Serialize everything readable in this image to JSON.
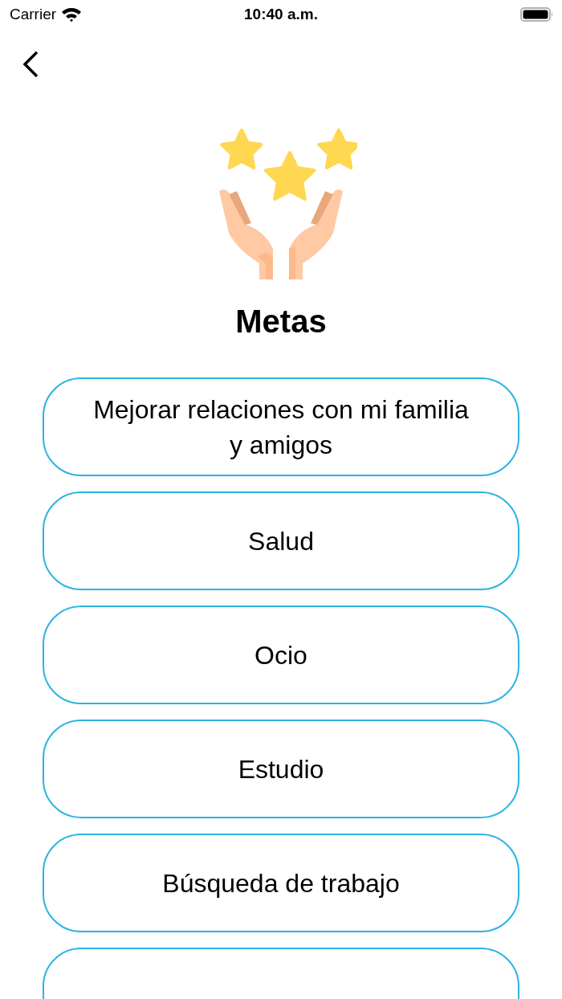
{
  "status_bar": {
    "carrier": "Carrier",
    "time": "10:40 a.m."
  },
  "title": "Metas",
  "goals": [
    {
      "kind": "goal",
      "label": "Mejorar relaciones con mi familia y amigos"
    },
    {
      "kind": "goal",
      "label": "Salud"
    },
    {
      "kind": "goal",
      "label": "Ocio"
    },
    {
      "kind": "goal",
      "label": "Estudio"
    },
    {
      "kind": "goal",
      "label": "Búsqueda de trabajo"
    },
    {
      "kind": "cut"
    }
  ]
}
